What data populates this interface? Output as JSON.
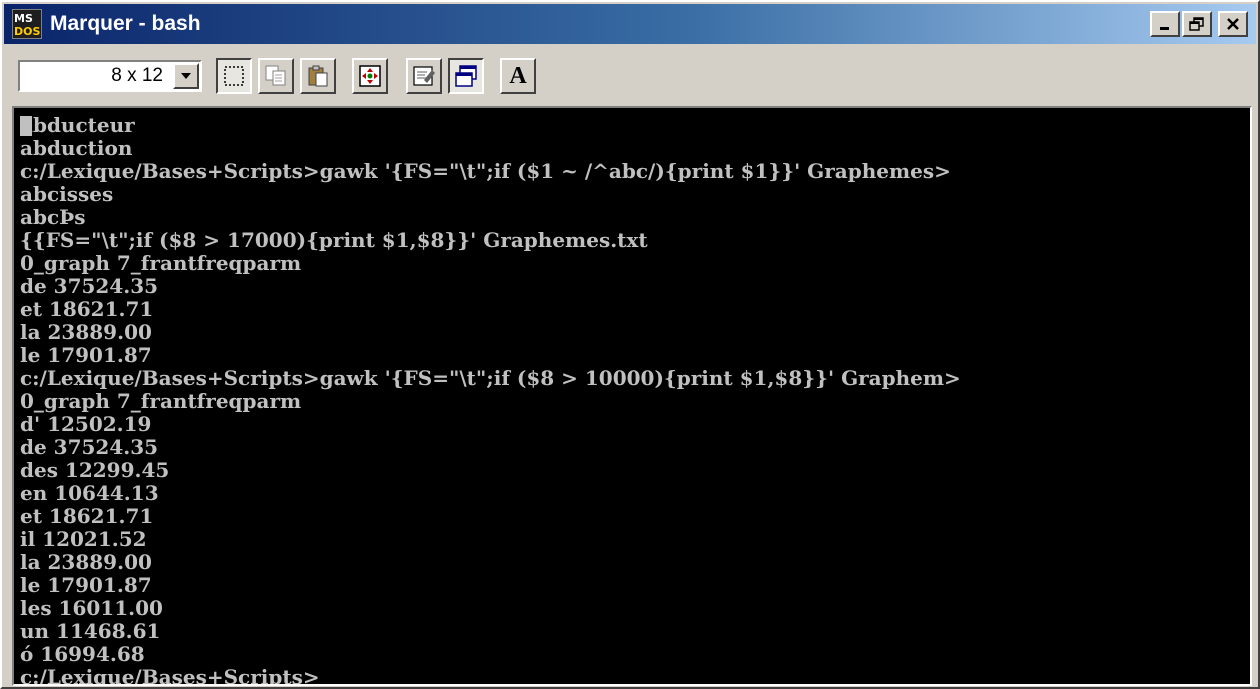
{
  "window": {
    "title": "Marquer - bash",
    "icon": "ms-dos-icon",
    "icon_label_top": "MS",
    "icon_label_bottom": "DOS"
  },
  "title_buttons": {
    "minimize": "_",
    "maximize": "□",
    "close": "×"
  },
  "toolbar": {
    "font_size_value": "8 x 12",
    "buttons": [
      {
        "name": "mark-button",
        "icon": "dotted-rectangle-icon"
      },
      {
        "name": "copy-button",
        "icon": "copy-icon"
      },
      {
        "name": "paste-button",
        "icon": "paste-icon"
      },
      {
        "name": "fullscreen-button",
        "icon": "fullscreen-icon"
      },
      {
        "name": "properties-button",
        "icon": "properties-icon"
      },
      {
        "name": "background-button",
        "icon": "background-icon"
      },
      {
        "name": "font-button",
        "icon": "font-icon",
        "label": "A"
      }
    ]
  },
  "terminal": {
    "lines": [
      "abducteur",
      "abduction",
      "c:/Lexique/Bases+Scripts>gawk '{FS=\"\\t\";if ($1 ~ /^abc/){print $1}}' Graphemes>",
      "abcisses",
      "abcÞs",
      "{{FS=\"\\t\";if ($8 > 17000){print $1,$8}}' Graphemes.txt",
      "0_graph 7_frantfreqparm",
      "de 37524.35",
      "et 18621.71",
      "la 23889.00",
      "le 17901.87",
      "c:/Lexique/Bases+Scripts>gawk '{FS=\"\\t\";if ($8 > 10000){print $1,$8}}' Graphem>",
      "0_graph 7_frantfreqparm",
      "d' 12502.19",
      "de 37524.35",
      "des 12299.45",
      "en 10644.13",
      "et 18621.71",
      "il 12021.52",
      "la 23889.00",
      "le 17901.87",
      "les 16011.00",
      "un 11468.61",
      "ó 16994.68",
      "c:/Lexique/Bases+Scripts>"
    ]
  },
  "colors": {
    "title_gradient_start": "#0a246a",
    "title_gradient_end": "#a6caf0",
    "terminal_bg": "#000000",
    "terminal_fg": "#c0c0c0",
    "chrome": "#d4d0c8"
  }
}
